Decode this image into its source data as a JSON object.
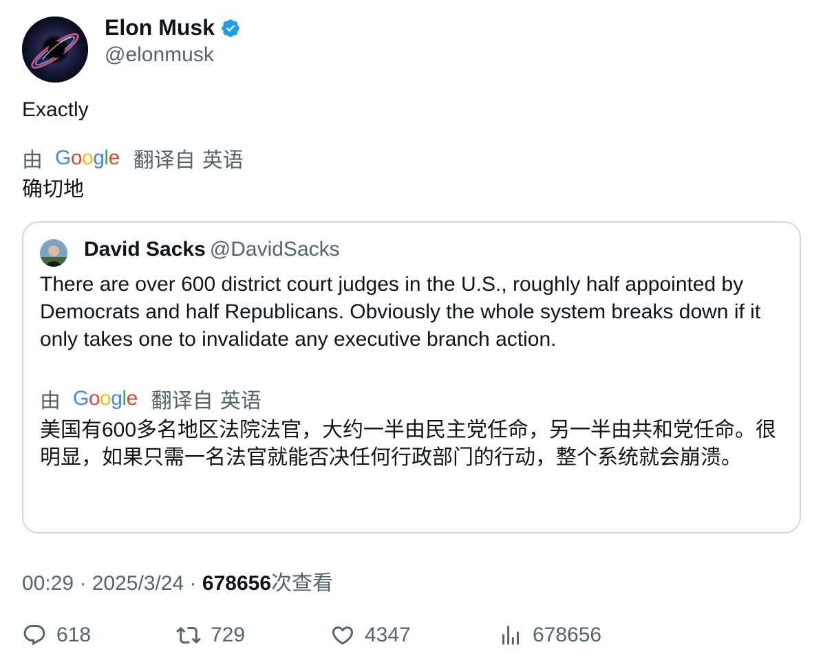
{
  "author": {
    "name": "Elon Musk",
    "handle": "@elonmusk",
    "verified": true,
    "avatar_icon": "black-hole-avatar"
  },
  "tweet": {
    "text": "Exactly",
    "translation": {
      "prefix": "由",
      "provider_letters": [
        "G",
        "o",
        "o",
        "g",
        "l",
        "e"
      ],
      "label": "翻译自",
      "language": "英语",
      "text": "确切地"
    }
  },
  "quote": {
    "name": "David Sacks",
    "handle": "@DavidSacks",
    "text": "There are over 600 district court judges in the U.S., roughly half appointed by Democrats and half Republicans. Obviously the whole system breaks down if it only takes one to invalidate any executive branch action.",
    "translation": {
      "prefix": "由",
      "label": "翻译自",
      "language": "英语",
      "text": "美国有600多名地区法院法官，大约一半由民主党任命，另一半由共和党任命。很明显，如果只需一名法官就能否决任何行政部门的行动，整个系统就会崩溃。"
    }
  },
  "meta": {
    "time": "00:29",
    "separator": " · ",
    "date": "2025/3/24",
    "views": "678656",
    "views_label": "次查看"
  },
  "actions": {
    "replies": "618",
    "retweets": "729",
    "likes": "4347",
    "views": "678656"
  },
  "colors": {
    "secondary_text": "#536471",
    "verified_blue": "#1d9bf0",
    "border": "#cfd9de"
  }
}
